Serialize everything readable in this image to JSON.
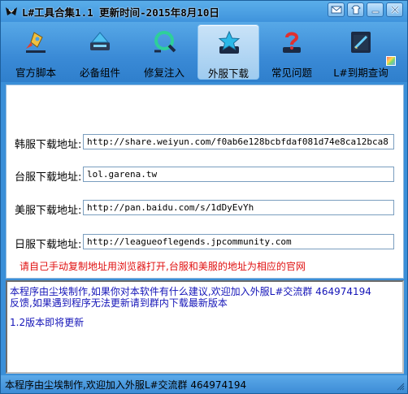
{
  "window": {
    "title": "L#工具合集1.1 更新时间-2015年8月10日",
    "title_bar_color": "#3f93dc"
  },
  "title_controls": [
    {
      "name": "mail-button",
      "icon": "mail-icon"
    },
    {
      "name": "theme-button",
      "icon": "theme-icon"
    },
    {
      "name": "minimize-button",
      "icon": "minimize-icon"
    },
    {
      "name": "close-button",
      "icon": "close-icon"
    }
  ],
  "toolbar": {
    "items": [
      {
        "label": "官方脚本",
        "icon": "rocket-icon"
      },
      {
        "label": "必备组件",
        "icon": "components-icon"
      },
      {
        "label": "修复注入",
        "icon": "repair-icon"
      },
      {
        "label": "外服下载",
        "icon": "star-download-icon",
        "active": true
      },
      {
        "label": "常见问题",
        "icon": "question-icon"
      },
      {
        "label": "L#到期查询",
        "icon": "calendar-icon"
      }
    ]
  },
  "downloads": [
    {
      "label": "韩服下载地址:",
      "url": "http://share.weiyun.com/f0ab6e128bcbfdaf081d74e8ca12bca8"
    },
    {
      "label": "台服下载地址:",
      "url": "lol.garena.tw"
    },
    {
      "label": "美服下载地址:",
      "url": "http://pan.baidu.com/s/1dDyEvYh"
    },
    {
      "label": "日服下载地址:",
      "url": "http://leagueoflegends.jpcommunity.com"
    }
  ],
  "notice": {
    "text": "请自己手动复制地址用浏览器打开,台服和美服的地址为相应的官网",
    "color": "#e01010"
  },
  "log": {
    "line1": "本程序由尘埃制作,如果你对本软件有什么建议,欢迎加入外服L#交流群 464974194",
    "line2": "反馈,如果遇到程序无法更新请到群内下载最新版本",
    "line3": "1.2版本即将更新",
    "color": "#1515b8"
  },
  "status": {
    "text": "本程序由尘埃制作,欢迎加入外服L#交流群 464974194"
  }
}
